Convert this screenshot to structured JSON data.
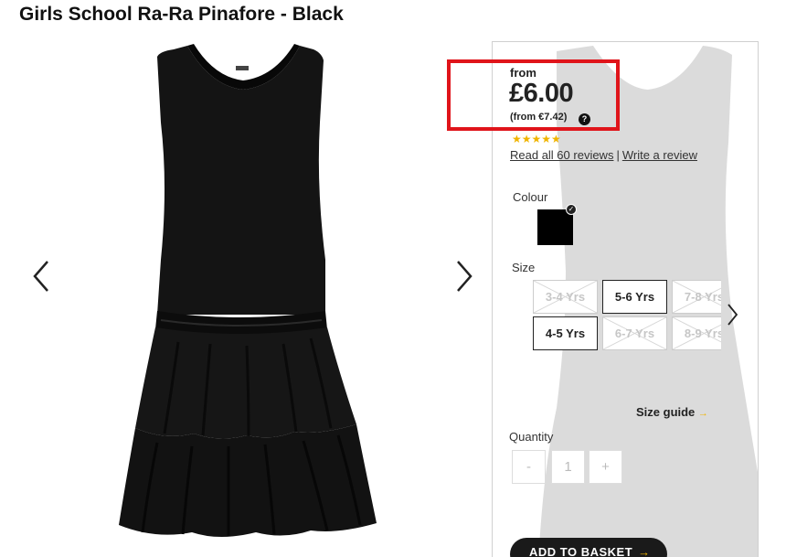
{
  "product": {
    "title": "Girls School Ra-Ra Pinafore - Black"
  },
  "gallery": {
    "prev_icon": "chevron-left-icon",
    "next_icon": "chevron-right-icon"
  },
  "price": {
    "from_label": "from",
    "amount": "£6.00",
    "euro": "(from €7.42)",
    "help_glyph": "?"
  },
  "rating": {
    "stars": 4.5,
    "stars_text": "★★★★★",
    "read_reviews": "Read all 60 reviews",
    "separator": "|",
    "write_review": "Write a review"
  },
  "colour": {
    "label": "Colour",
    "selected": "#000000"
  },
  "size": {
    "label": "Size",
    "options": [
      {
        "label": "3-4 Yrs",
        "available": false
      },
      {
        "label": "5-6 Yrs",
        "available": true
      },
      {
        "label": "7-8 Yrs",
        "available": false
      },
      {
        "label": "4-5 Yrs",
        "available": true
      },
      {
        "label": "6-7 Yrs",
        "available": false
      },
      {
        "label": "8-9 Yrs",
        "available": false
      }
    ],
    "guide": "Size guide",
    "guide_arrow": "→"
  },
  "quantity": {
    "label": "Quantity",
    "minus": "-",
    "value": "1",
    "plus": "+"
  },
  "basket": {
    "label": "ADD TO BASKET",
    "arrow": "→"
  },
  "colors": {
    "highlight": "#e0141a",
    "star": "#f0b400",
    "button": "#1a1a1a"
  }
}
